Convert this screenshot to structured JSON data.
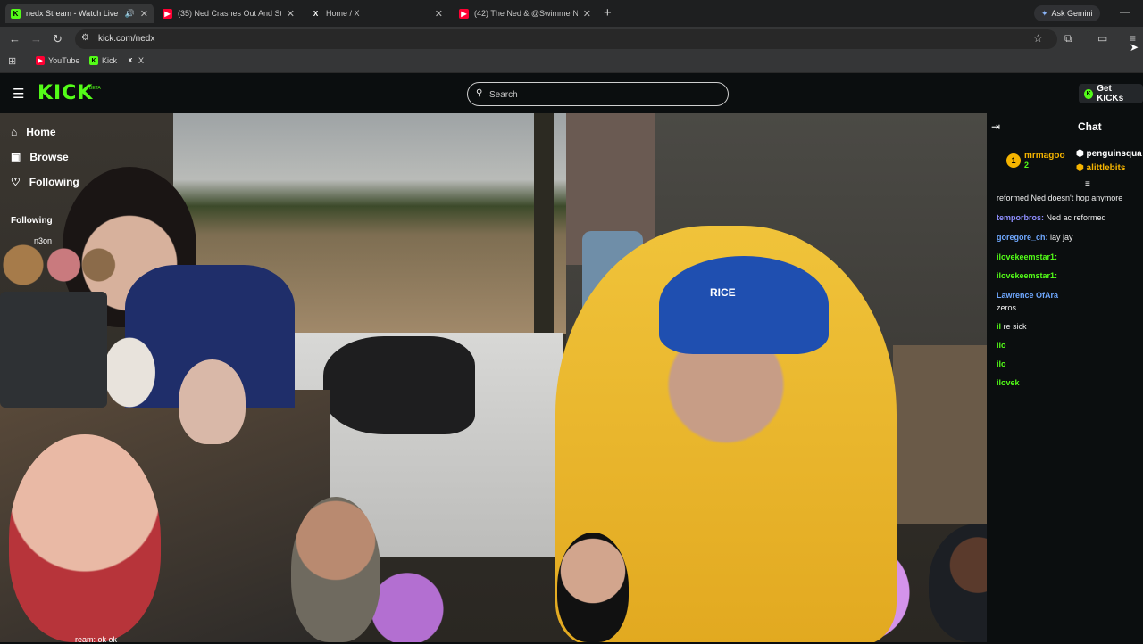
{
  "browser": {
    "tabs": [
      {
        "title": "nedx Stream - Watch Live o",
        "favicon": "K",
        "color": "#53fc18",
        "active": true
      },
      {
        "title": "(35) Ned Crashes Out And Star",
        "favicon": "▶",
        "color": "#ff0033",
        "active": false
      },
      {
        "title": "Home / X",
        "favicon": "X",
        "color": "#ffffff",
        "active": false
      },
      {
        "title": "(42) The Ned & @SwimmerNic",
        "favicon": "▶",
        "color": "#ff0033",
        "active": false
      }
    ],
    "ask_gemini": "Ask Gemini",
    "url": "kick.com/nedx",
    "bookmarks": [
      {
        "label": "YouTube",
        "favicon": "▶",
        "color": "#ff0033"
      },
      {
        "label": "Kick",
        "favicon": "K",
        "color": "#53fc18"
      },
      {
        "label": "X",
        "favicon": "X",
        "color": "#ffffff"
      }
    ]
  },
  "kick": {
    "logo": "KICK",
    "beta": "BETA",
    "search_placeholder": "Search",
    "get_kicks": "Get KICKs",
    "accent": "#53fc18"
  },
  "sidebar": {
    "items": [
      {
        "label": "Home",
        "icon": "home-icon"
      },
      {
        "label": "Browse",
        "icon": "browse-icon"
      },
      {
        "label": "Following",
        "icon": "heart-icon"
      }
    ],
    "following_label": "Following",
    "following_user": "n3on"
  },
  "chat": {
    "title": "Chat",
    "gifters": [
      {
        "rank": "1",
        "name": "mrmagoo",
        "sub": "2"
      },
      {
        "name": "penguinsqua"
      },
      {
        "name": "alittlebits"
      }
    ],
    "messages": [
      {
        "user": "",
        "text": "reformed Ned doesn't hop anymore",
        "color": "#e8e8e8"
      },
      {
        "user": "temporbros:",
        "text": "Ned ac     reformed",
        "color": "#8f8fff"
      },
      {
        "user": "goregore_ch:",
        "text": "lay jay",
        "color": "#6fa8ff"
      },
      {
        "user": "ilovekeemstar1:",
        "text": "",
        "color": "#53fc18"
      },
      {
        "user": "ilovekeemstar1:",
        "text": "",
        "color": "#53fc18"
      },
      {
        "user": "Lawrence OfAra",
        "text": "",
        "color": "#6fa8ff"
      },
      {
        "user": "",
        "text": "zeros",
        "color": "#e8e8e8"
      },
      {
        "user": "il",
        "text": "re sick",
        "color": "#53fc18"
      },
      {
        "user": "ilo",
        "text": "",
        "color": "#53fc18"
      },
      {
        "user": "ilo",
        "text": "",
        "color": "#53fc18"
      },
      {
        "user": "ilovek",
        "text": "",
        "color": "#53fc18"
      }
    ]
  },
  "video": {
    "caption": "ream: ok ok",
    "cap_text": "RICE"
  }
}
